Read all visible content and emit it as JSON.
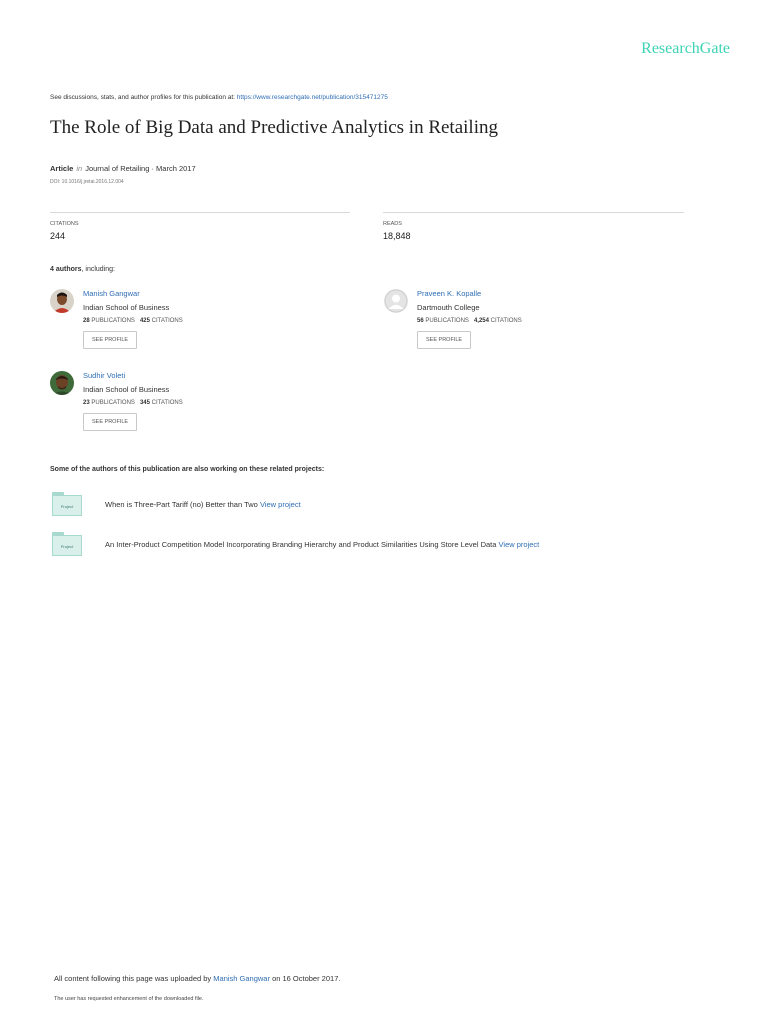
{
  "header": {
    "logo": "ResearchGate",
    "discussion_text": "See discussions, stats, and author profiles for this publication at: ",
    "publication_url": "https://www.researchgate.net/publication/315471275"
  },
  "publication": {
    "title": "The Role of Big Data and Predictive Analytics in Retailing",
    "type": "Article",
    "in_word": "in",
    "journal": "Journal of Retailing · March 2017",
    "doi": "DOI: 10.1016/j.jretai.2016.12.004"
  },
  "stats": {
    "citations_label": "CITATIONS",
    "citations_value": "244",
    "reads_label": "READS",
    "reads_value": "18,848"
  },
  "authors_section": {
    "count": "4 authors",
    "suffix": ", including:"
  },
  "authors": [
    {
      "name": "Manish Gangwar",
      "institution": "Indian School of Business",
      "publications": "28",
      "publications_label": "PUBLICATIONS",
      "citations": "425",
      "citations_label": "CITATIONS",
      "button": "SEE PROFILE"
    },
    {
      "name": "Praveen K. Kopalle",
      "institution": "Dartmouth College",
      "publications": "56",
      "publications_label": "PUBLICATIONS",
      "citations": "4,254",
      "citations_label": "CITATIONS",
      "button": "SEE PROFILE"
    },
    {
      "name": "Sudhir Voleti",
      "institution": "Indian School of Business",
      "publications": "23",
      "publications_label": "PUBLICATIONS",
      "citations": "345",
      "citations_label": "CITATIONS",
      "button": "SEE PROFILE"
    }
  ],
  "projects_section": {
    "heading": "Some of the authors of this publication are also working on these related projects:",
    "folder_label": "Project",
    "items": [
      {
        "title": "When is Three-Part Tariff (no) Better than Two",
        "link": "View project"
      },
      {
        "title": "An Inter-Product Competition Model Incorporating Branding Hierarchy and Product Similarities Using Store Level Data",
        "link": "View project"
      }
    ]
  },
  "footer": {
    "upload_prefix": "All content following this page was uploaded by ",
    "uploader": "Manish Gangwar",
    "upload_suffix": " on 16 October 2017.",
    "note": "The user has requested enhancement of the downloaded file."
  },
  "colors": {
    "brand": "#3dd3b4",
    "link": "#2f6eb4"
  }
}
